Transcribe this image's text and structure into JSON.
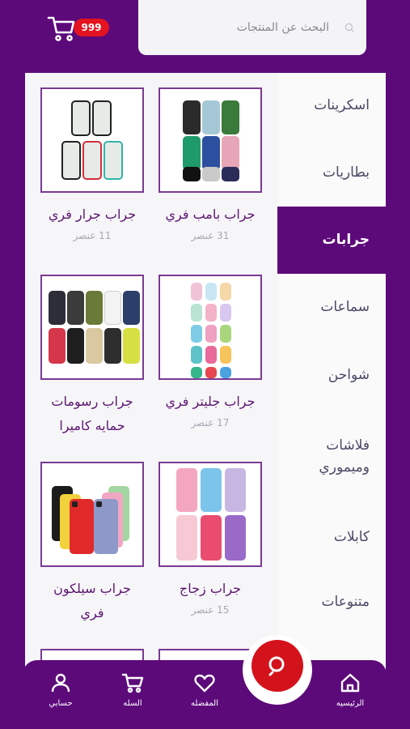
{
  "header": {
    "search_placeholder": "البحث عن المنتجات",
    "cart_badge": "999"
  },
  "categories": [
    {
      "label": "اسكرينات"
    },
    {
      "label": "بطاريات"
    },
    {
      "label": "جرابات",
      "active": true
    },
    {
      "label": "سماعات"
    },
    {
      "label": "شواحن"
    },
    {
      "label": "فلاشات وميموري"
    },
    {
      "label": "كابلات"
    },
    {
      "label": "متنوعات"
    }
  ],
  "products": [
    {
      "name": "جراب بامب فري",
      "count": "31 عنصر"
    },
    {
      "name": "جراب جرار فري",
      "count": "11 عنصر"
    },
    {
      "name": "جراب جليتر فري",
      "count": "17 عنصر"
    },
    {
      "name": "جراب رسومات حمايه كاميرا",
      "count": ""
    },
    {
      "name": "جراب زجاج",
      "count": "15 عنصر"
    },
    {
      "name": "جراب سيلكون فري",
      "count": ""
    }
  ],
  "bottom_nav": [
    {
      "label": "الرئيسيه",
      "icon": "home-icon"
    },
    {
      "label": "المفضله",
      "icon": "heart-icon"
    },
    {
      "label": "السله",
      "icon": "cart-icon"
    },
    {
      "label": "حسابي",
      "icon": "user-icon"
    }
  ],
  "colors": {
    "brand_purple": "#5c0a7a",
    "accent_red": "#d4121c",
    "badge_red": "#e3141f"
  }
}
